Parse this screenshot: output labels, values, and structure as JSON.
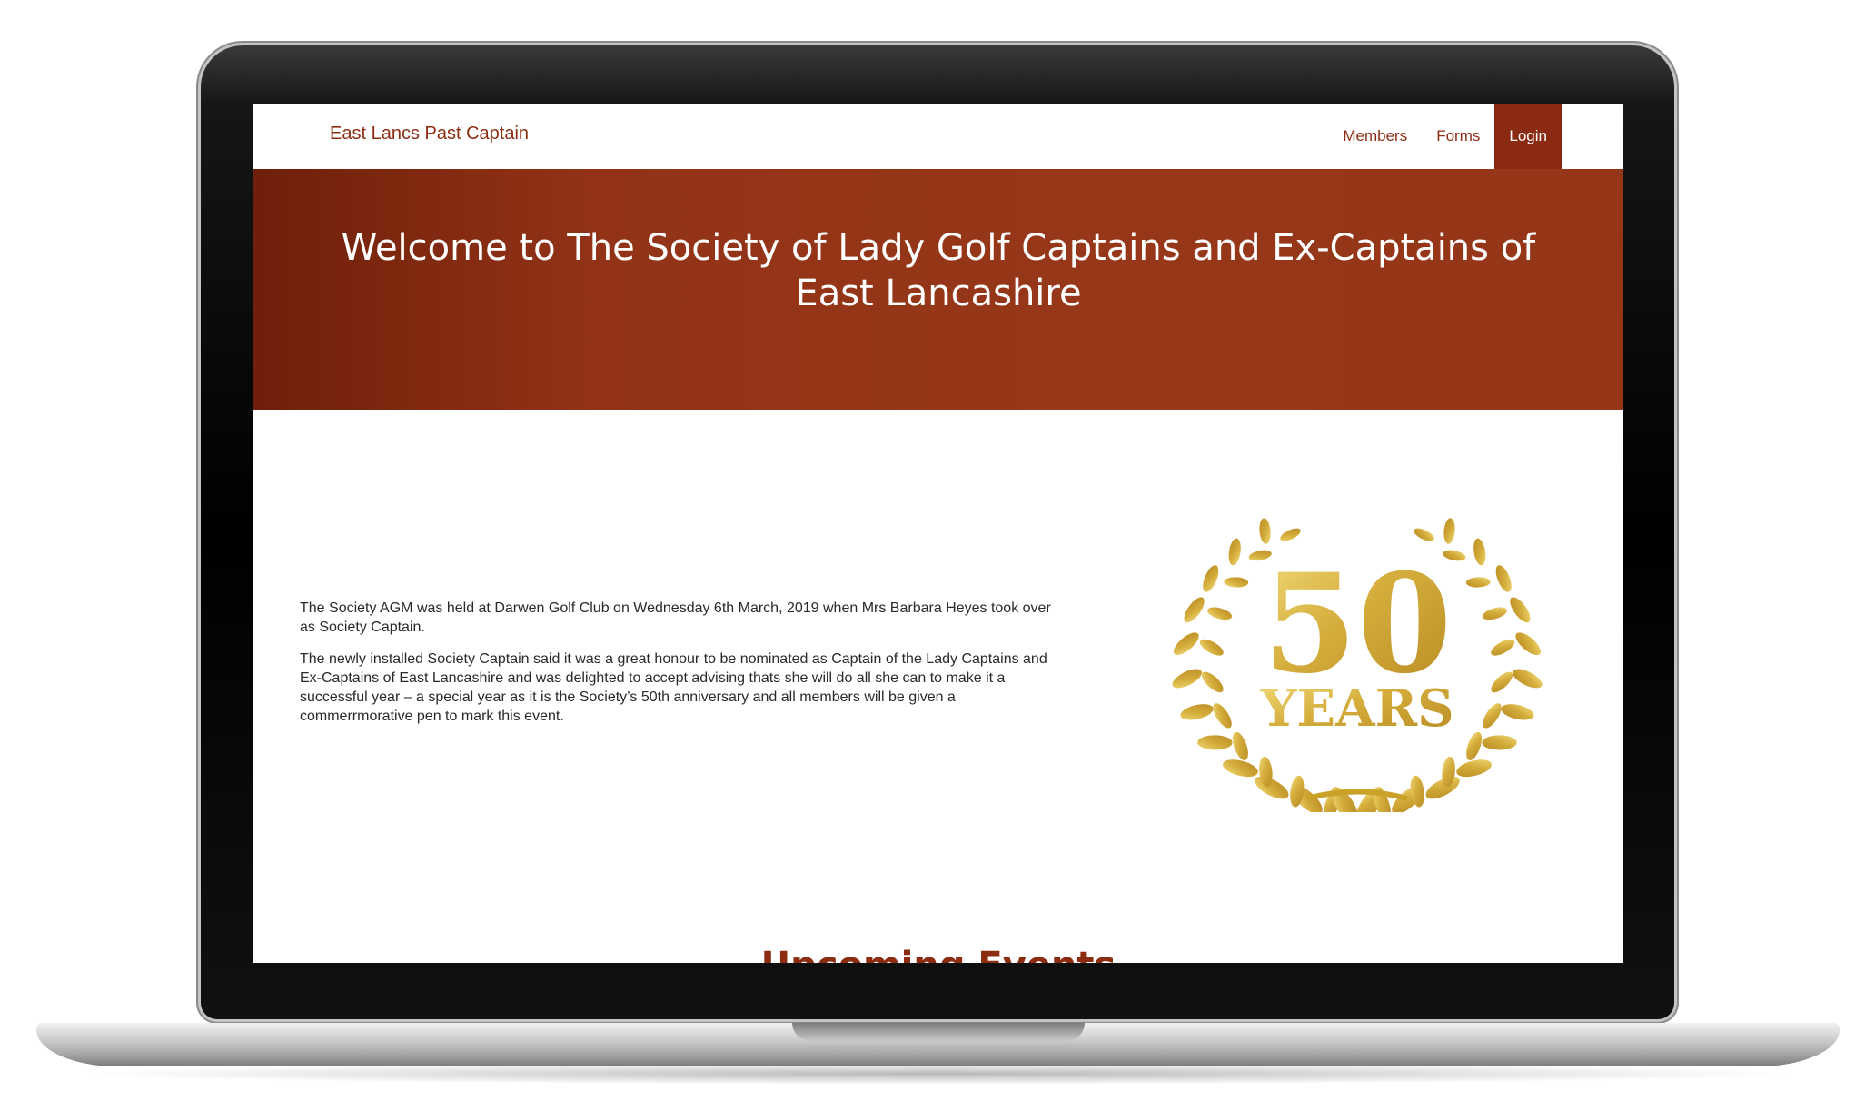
{
  "navbar": {
    "brand": "East Lancs Past Captain",
    "links": [
      "Members",
      "Forms",
      "Login"
    ],
    "active_link": "Login"
  },
  "hero": {
    "title": "Welcome to The Society of Lady Golf Captains and Ex-Captains of East Lancashire"
  },
  "content": {
    "paragraphs": [
      "The Society AGM was held at Darwen Golf Club on Wednesday 6th March, 2019 when Mrs Barbara Heyes took over as Society Captain.",
      "The newly installed Society Captain said it was a great honour to be nominated as Captain of the Lady Captains and Ex-Captains of East Lancashire and was delighted to accept advising thats she will do all she can to make it a successful year – a special year as it is the Society’s 50th anniversary and all members will be given a commerrmorative pen to mark this event."
    ]
  },
  "emblem": {
    "number": "50",
    "word": "YEARS",
    "icon": "laurel-wreath-icon"
  },
  "upcoming": {
    "title": "Upcoming Events"
  },
  "colors": {
    "brand": "#8c2d12",
    "hero_start": "#6f1f0a",
    "hero_end": "#953618",
    "gold": "#c9a227"
  }
}
